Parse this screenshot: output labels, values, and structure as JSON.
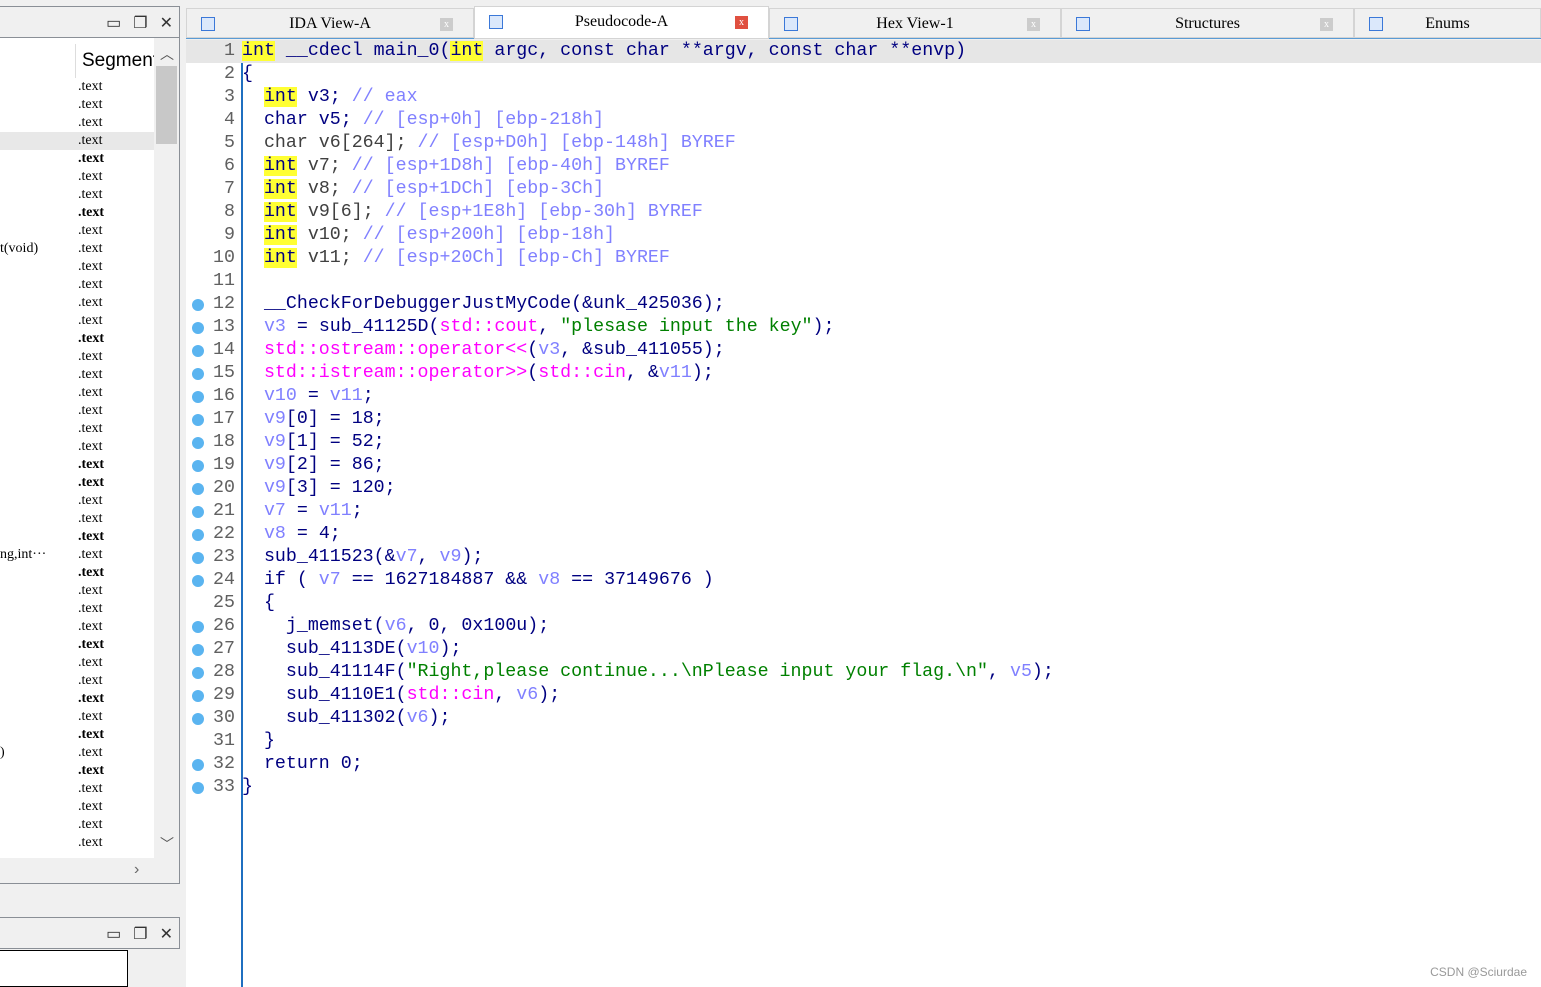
{
  "left_panel": {
    "segments_header": "Segment",
    "left_fragments": {
      "9": "t(void)",
      "26": "ng,int···",
      "37": ")"
    },
    "selected_row": 3,
    "bold_rows": [
      4,
      7,
      14,
      21,
      22,
      25,
      27,
      31,
      34,
      36,
      38
    ],
    "segment_label": ".text",
    "row_count": 43
  },
  "tabs": [
    {
      "label": "IDA View-A",
      "active": false
    },
    {
      "label": "Pseudocode-A",
      "active": true
    },
    {
      "label": "Hex View-1",
      "active": false
    },
    {
      "label": "Structures",
      "active": false
    },
    {
      "label": "Enums",
      "active": false
    }
  ],
  "code": [
    {
      "n": "1",
      "bp": false,
      "t": [
        [
          "hl",
          "int"
        ],
        [
          "k",
          " __cdecl main_0("
        ],
        [
          "hl",
          "int"
        ],
        [
          "k",
          " argc, const char **argv, const char **envp)"
        ]
      ]
    },
    {
      "n": "2",
      "bp": false,
      "t": [
        [
          "k",
          "{"
        ]
      ]
    },
    {
      "n": "3",
      "bp": false,
      "t": [
        [
          "k",
          "  "
        ],
        [
          "hl",
          "int"
        ],
        [
          "k",
          " v3; "
        ],
        [
          "c",
          "// eax"
        ]
      ]
    },
    {
      "n": "4",
      "bp": false,
      "t": [
        [
          "k",
          "  char v5; "
        ],
        [
          "c",
          "// [esp+0h] [ebp-218h]"
        ]
      ]
    },
    {
      "n": "5",
      "bp": false,
      "t": [
        [
          "g",
          "  char v6[264]; "
        ],
        [
          "c",
          "// [esp+D0h] [ebp-148h] BYREF"
        ]
      ]
    },
    {
      "n": "6",
      "bp": false,
      "t": [
        [
          "g",
          "  "
        ],
        [
          "hl",
          "int"
        ],
        [
          "g",
          " v7; "
        ],
        [
          "c",
          "// [esp+1D8h] [ebp-40h] BYREF"
        ]
      ]
    },
    {
      "n": "7",
      "bp": false,
      "t": [
        [
          "g",
          "  "
        ],
        [
          "hl",
          "int"
        ],
        [
          "g",
          " v8; "
        ],
        [
          "c",
          "// [esp+1DCh] [ebp-3Ch]"
        ]
      ]
    },
    {
      "n": "8",
      "bp": false,
      "t": [
        [
          "g",
          "  "
        ],
        [
          "hl",
          "int"
        ],
        [
          "g",
          " v9[6]; "
        ],
        [
          "c",
          "// [esp+1E8h] [ebp-30h] BYREF"
        ]
      ]
    },
    {
      "n": "9",
      "bp": false,
      "t": [
        [
          "g",
          "  "
        ],
        [
          "hl",
          "int"
        ],
        [
          "g",
          " v10; "
        ],
        [
          "c",
          "// [esp+200h] [ebp-18h]"
        ]
      ]
    },
    {
      "n": "10",
      "bp": false,
      "t": [
        [
          "g",
          "  "
        ],
        [
          "hl",
          "int"
        ],
        [
          "g",
          " v11; "
        ],
        [
          "c",
          "// [esp+20Ch] [ebp-Ch] BYREF"
        ]
      ]
    },
    {
      "n": "11",
      "bp": false,
      "t": []
    },
    {
      "n": "12",
      "bp": true,
      "t": [
        [
          "k",
          "  __CheckForDebuggerJustMyCode(&unk_425036);"
        ]
      ]
    },
    {
      "n": "13",
      "bp": true,
      "t": [
        [
          "k",
          "  "
        ],
        [
          "v",
          "v3"
        ],
        [
          "k",
          " = sub_41125D("
        ],
        [
          "m",
          "std::cout"
        ],
        [
          "k",
          ", "
        ],
        [
          "s",
          "\"plesase input the key\""
        ],
        [
          "k",
          ");"
        ]
      ]
    },
    {
      "n": "14",
      "bp": true,
      "t": [
        [
          "k",
          "  "
        ],
        [
          "m",
          "std::ostream::operator<<"
        ],
        [
          "k",
          "("
        ],
        [
          "v",
          "v3"
        ],
        [
          "k",
          ", &sub_411055);"
        ]
      ]
    },
    {
      "n": "15",
      "bp": true,
      "t": [
        [
          "k",
          "  "
        ],
        [
          "m",
          "std::istream::operator>>"
        ],
        [
          "k",
          "("
        ],
        [
          "m",
          "std::cin"
        ],
        [
          "k",
          ", &"
        ],
        [
          "v",
          "v11"
        ],
        [
          "k",
          ");"
        ]
      ]
    },
    {
      "n": "16",
      "bp": true,
      "t": [
        [
          "k",
          "  "
        ],
        [
          "v",
          "v10"
        ],
        [
          "k",
          " = "
        ],
        [
          "v",
          "v11"
        ],
        [
          "k",
          ";"
        ]
      ]
    },
    {
      "n": "17",
      "bp": true,
      "t": [
        [
          "k",
          "  "
        ],
        [
          "v",
          "v9"
        ],
        [
          "k",
          "[0] = 18;"
        ]
      ]
    },
    {
      "n": "18",
      "bp": true,
      "t": [
        [
          "k",
          "  "
        ],
        [
          "v",
          "v9"
        ],
        [
          "k",
          "[1] = 52;"
        ]
      ]
    },
    {
      "n": "19",
      "bp": true,
      "t": [
        [
          "k",
          "  "
        ],
        [
          "v",
          "v9"
        ],
        [
          "k",
          "[2] = 86;"
        ]
      ]
    },
    {
      "n": "20",
      "bp": true,
      "t": [
        [
          "k",
          "  "
        ],
        [
          "v",
          "v9"
        ],
        [
          "k",
          "[3] = 120;"
        ]
      ]
    },
    {
      "n": "21",
      "bp": true,
      "t": [
        [
          "k",
          "  "
        ],
        [
          "v",
          "v7"
        ],
        [
          "k",
          " = "
        ],
        [
          "v",
          "v11"
        ],
        [
          "k",
          ";"
        ]
      ]
    },
    {
      "n": "22",
      "bp": true,
      "t": [
        [
          "k",
          "  "
        ],
        [
          "v",
          "v8"
        ],
        [
          "k",
          " = 4;"
        ]
      ]
    },
    {
      "n": "23",
      "bp": true,
      "t": [
        [
          "k",
          "  sub_411523(&"
        ],
        [
          "v",
          "v7"
        ],
        [
          "k",
          ", "
        ],
        [
          "v",
          "v9"
        ],
        [
          "k",
          ");"
        ]
      ]
    },
    {
      "n": "24",
      "bp": true,
      "t": [
        [
          "k",
          "  if ( "
        ],
        [
          "v",
          "v7"
        ],
        [
          "k",
          " == 1627184887 && "
        ],
        [
          "v",
          "v8"
        ],
        [
          "k",
          " == 37149676 )"
        ]
      ]
    },
    {
      "n": "25",
      "bp": false,
      "t": [
        [
          "k",
          "  {"
        ]
      ]
    },
    {
      "n": "26",
      "bp": true,
      "t": [
        [
          "k",
          "    j_memset("
        ],
        [
          "v",
          "v6"
        ],
        [
          "k",
          ", 0, 0x100u);"
        ]
      ]
    },
    {
      "n": "27",
      "bp": true,
      "t": [
        [
          "k",
          "    sub_4113DE("
        ],
        [
          "v",
          "v10"
        ],
        [
          "k",
          ");"
        ]
      ]
    },
    {
      "n": "28",
      "bp": true,
      "t": [
        [
          "k",
          "    sub_41114F("
        ],
        [
          "s",
          "\"Right,please continue...\\nPlease input your flag.\\n\""
        ],
        [
          "k",
          ", "
        ],
        [
          "v",
          "v5"
        ],
        [
          "k",
          ");"
        ]
      ]
    },
    {
      "n": "29",
      "bp": true,
      "t": [
        [
          "k",
          "    sub_4110E1("
        ],
        [
          "m",
          "std::cin"
        ],
        [
          "k",
          ", "
        ],
        [
          "v",
          "v6"
        ],
        [
          "k",
          ");"
        ]
      ]
    },
    {
      "n": "30",
      "bp": true,
      "t": [
        [
          "k",
          "    sub_411302("
        ],
        [
          "v",
          "v6"
        ],
        [
          "k",
          ");"
        ]
      ]
    },
    {
      "n": "31",
      "bp": false,
      "t": [
        [
          "k",
          "  }"
        ]
      ]
    },
    {
      "n": "32",
      "bp": true,
      "t": [
        [
          "k",
          "  return 0;"
        ]
      ]
    },
    {
      "n": "33",
      "bp": true,
      "t": [
        [
          "k",
          "}"
        ]
      ]
    }
  ],
  "watermark": "CSDN @Sciurdae"
}
